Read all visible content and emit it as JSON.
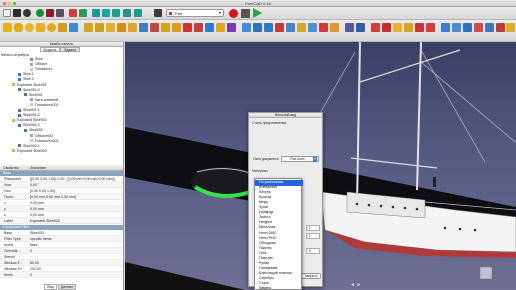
{
  "window": {
    "title": "FreeCAD 0.18"
  },
  "toolbar": {
    "workbench_value": "Part",
    "colors": {
      "record": "#d81414",
      "stop": "#444444",
      "play": "#22a84a"
    }
  },
  "combo_view": {
    "title": "Комбо панель",
    "tabs": [
      "Модель",
      "Задачи"
    ],
    "section_label": "Метки и атрибуты",
    "tree": [
      {
        "label": "Slice",
        "depth": 4,
        "icon": "link-icon"
      },
      {
        "label": "Объект",
        "depth": 4,
        "icon": "object-icon"
      },
      {
        "label": "Плоскость",
        "depth": 4,
        "icon": "plane-icon"
      },
      {
        "label": "Slice.1",
        "depth": 2,
        "icon": "part-icon"
      },
      {
        "label": "Slice.2",
        "depth": 2,
        "icon": "part-icon"
      },
      {
        "label": "Exploded Slice001",
        "depth": 1,
        "icon": "folder-icon"
      },
      {
        "label": "Slice001.0",
        "depth": 2,
        "icon": "part-icon"
      },
      {
        "label": "Slice001",
        "depth": 3,
        "icon": "part-icon"
      },
      {
        "label": "Ката штевней",
        "depth": 4,
        "icon": "object-icon"
      },
      {
        "label": "Плоскость001",
        "depth": 4,
        "icon": "plane-icon"
      },
      {
        "label": "Slice001.1",
        "depth": 2,
        "icon": "part-icon"
      },
      {
        "label": "Slice001.2",
        "depth": 2,
        "icon": "part-icon"
      },
      {
        "label": "Exploded Slice002",
        "depth": 1,
        "icon": "folder-icon"
      },
      {
        "label": "Slice002.0",
        "depth": 2,
        "icon": "part-icon"
      },
      {
        "label": "Slice002",
        "depth": 3,
        "icon": "part-icon"
      },
      {
        "label": "Объект002",
        "depth": 4,
        "icon": "object-icon"
      },
      {
        "label": "Плоскость002",
        "depth": 4,
        "icon": "plane-icon"
      },
      {
        "label": "Slice002.1",
        "depth": 2,
        "icon": "part-icon"
      },
      {
        "label": "Exploded Slice003",
        "depth": 1,
        "icon": "folder-icon"
      }
    ]
  },
  "properties": {
    "headers": [
      "Свойство",
      "Значение"
    ],
    "group_base": "Base",
    "rows": [
      {
        "k": "Placement",
        "v": "[(0,00 0,00 1,00) 0,00 ; (0,00 mm  0,00 mm  0,00 mm)]"
      },
      {
        "k": "Угол",
        "v": "0,00 °"
      },
      {
        "k": "Ось",
        "v": "[0,00 0,00 1,00]"
      },
      {
        "k": "Поло...",
        "v": "[0,00 mm  0,00 mm  0,00 mm]"
      },
      {
        "k": "x",
        "v": "0,00 mm"
      },
      {
        "k": "y",
        "v": "0,00 mm"
      },
      {
        "k": "z",
        "v": "0,00 mm"
      },
      {
        "k": "Label",
        "v": "Exploded Slice003"
      }
    ],
    "group_filter": "Compound Filter",
    "rows2": [
      {
        "k": "Base",
        "v": "Slice003"
      },
      {
        "k": "Filter Type",
        "v": "specific items"
      },
      {
        "k": "Invert",
        "v": "false"
      },
      {
        "k": "Override ...",
        "v": "0"
      },
      {
        "k": "Stencil",
        "v": ""
      },
      {
        "k": "Window F...",
        "v": "80,00"
      },
      {
        "k": "Window To",
        "v": "100,00"
      },
      {
        "k": "Items",
        "v": "0"
      }
    ],
    "bottom_tabs": [
      "Вид",
      "Данные"
    ]
  },
  "dialog": {
    "title": "Внешний вид",
    "section": "Стиль представления",
    "doc_label": "Окно документа:",
    "doc_value": "Flat Lines",
    "material_label": "Материал",
    "close": "Закрыть"
  },
  "material_list": [
    "По умолчанию",
    "Алюминий",
    "Латунь",
    "Бронза",
    "Медь",
    "Хром",
    "Изумруд",
    "Золото",
    "Нефрит",
    "Металлик",
    "Неон GNC",
    "Неон PHC",
    "Обсидиан",
    "Пьютер",
    "Гипс",
    "Пластик",
    "Рубин",
    "Глянцевый",
    "Блестящий пластик",
    "Серебро",
    "Сталь",
    "Камень"
  ]
}
